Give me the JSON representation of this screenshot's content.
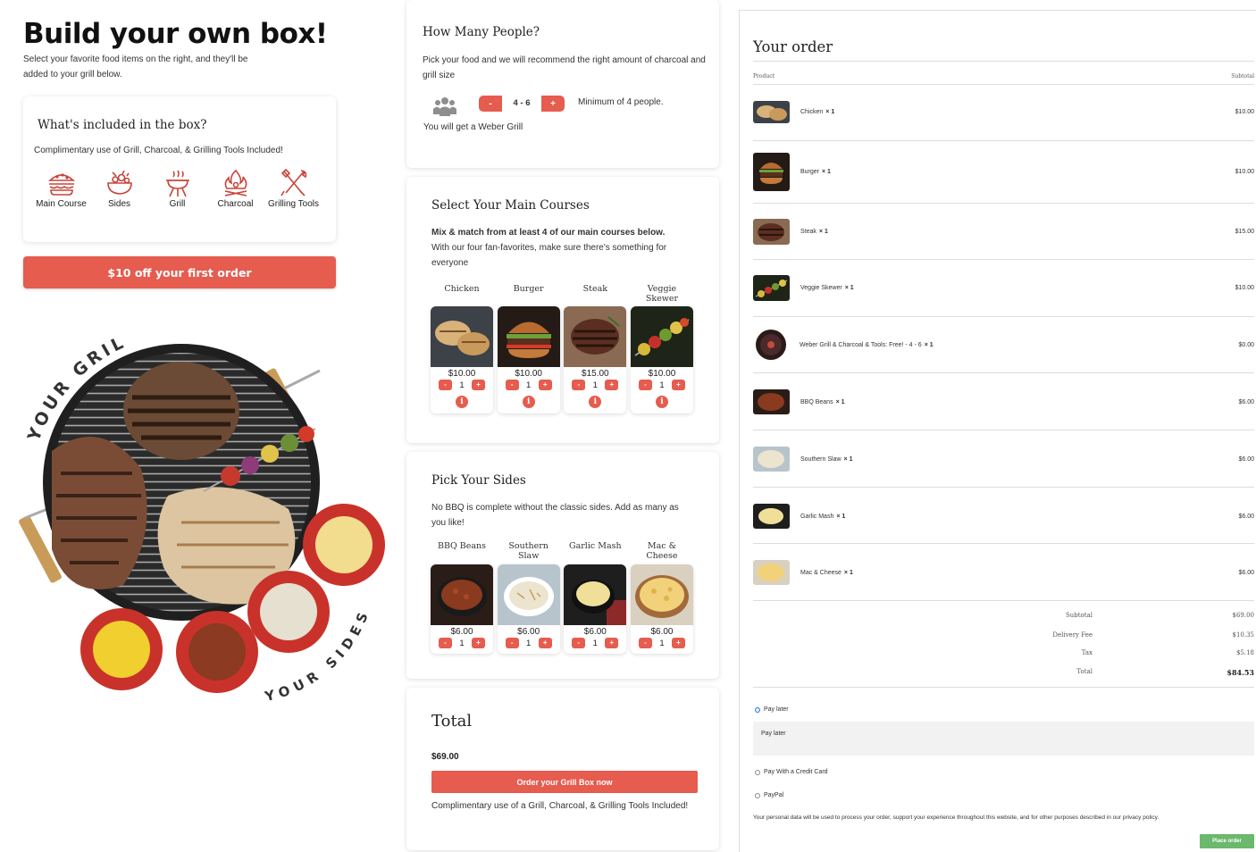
{
  "hero": {
    "title": "Build your own box!",
    "subtitle": "Select your favorite food items on the right, and they'll be added to your grill below."
  },
  "included": {
    "title": "What's included in the box?",
    "text": "Complimentary use of Grill, Charcoal, & Grilling Tools Included!",
    "items": [
      {
        "label": "Main Course",
        "icon": "burger-icon"
      },
      {
        "label": "Sides",
        "icon": "salad-bowl-icon"
      },
      {
        "label": "Grill",
        "icon": "grill-icon"
      },
      {
        "label": "Charcoal",
        "icon": "fire-icon"
      },
      {
        "label": "Grilling Tools",
        "icon": "tools-icon"
      }
    ]
  },
  "promo_button": "$10 off your first order",
  "grill_art": {
    "top_text": "YOUR GRILL",
    "bottom_text": "YOUR SIDES"
  },
  "people": {
    "title": "How Many People?",
    "text": "Pick your food and we will recommend the right amount of charcoal and grill size",
    "minus": "-",
    "value": "4 - 6",
    "plus": "+",
    "minimum_note": "Minimum of 4 people.",
    "grill_note": "You will get a Weber Grill"
  },
  "mains": {
    "title": "Select Your Main Courses",
    "text_bold": "Mix & match from at least 4 of our main courses below.",
    "text": "With our four fan-favorites, make sure there's something for everyone",
    "items": [
      {
        "name": "Chicken",
        "price": "$10.00",
        "qty": "1"
      },
      {
        "name": "Burger",
        "price": "$10.00",
        "qty": "1"
      },
      {
        "name": "Steak",
        "price": "$15.00",
        "qty": "1"
      },
      {
        "name": "Veggie Skewer",
        "price": "$10.00",
        "qty": "1"
      }
    ]
  },
  "sides": {
    "title": "Pick Your Sides",
    "text": "No BBQ is complete without the classic sides. Add as many as you like!",
    "items": [
      {
        "name": "BBQ Beans",
        "price": "$6.00",
        "qty": "1"
      },
      {
        "name": "Southern Slaw",
        "price": "$6.00",
        "qty": "1"
      },
      {
        "name": "Garlic Mash",
        "price": "$6.00",
        "qty": "1"
      },
      {
        "name": "Mac & Cheese",
        "price": "$6.00",
        "qty": "1"
      }
    ]
  },
  "total": {
    "title": "Total",
    "value": "$69.00",
    "button": "Order your Grill Box now",
    "note": "Complimentary use of a Grill, Charcoal, & Grilling Tools Included!"
  },
  "order": {
    "title": "Your order",
    "col_product": "Product",
    "col_subtotal": "Subtotal",
    "items": [
      {
        "name": "Chicken",
        "qty": "× 1",
        "price": "$10.00"
      },
      {
        "name": "Burger",
        "qty": "× 1",
        "price": "$10.00"
      },
      {
        "name": "Steak",
        "qty": "× 1",
        "price": "$15.00"
      },
      {
        "name": "Veggie Skewer",
        "qty": "× 1",
        "price": "$10.00"
      },
      {
        "name": "Weber Grill & Charcoal & Tools: Free! - 4 - 6",
        "qty": "× 1",
        "price": "$0.00"
      },
      {
        "name": "BBQ Beans",
        "qty": "× 1",
        "price": "$6.00"
      },
      {
        "name": "Southern Slaw",
        "qty": "× 1",
        "price": "$6.00"
      },
      {
        "name": "Garlic Mash",
        "qty": "× 1",
        "price": "$6.00"
      },
      {
        "name": "Mac & Cheese",
        "qty": "× 1",
        "price": "$6.00"
      }
    ],
    "totals": [
      {
        "label": "Subtotal",
        "value": "$69.00"
      },
      {
        "label": "Delivery Fee",
        "value": "$10.35"
      },
      {
        "label": "Tax",
        "value": "$5.18"
      },
      {
        "label": "Total",
        "value": "$84.53"
      }
    ],
    "payment": {
      "pay_later": "Pay later",
      "pay_later_desc": "Pay later",
      "credit_card": "Pay With a Credit Card",
      "paypal": "PayPal"
    },
    "privacy": "Your personal data will be used to process your order, support your experience throughout this website, and for other purposes described in our privacy policy.",
    "place_order": "Place order"
  },
  "colors": {
    "accent": "#e65c4f",
    "place_order": "#6cb86c",
    "radio_selected": "#2b72e6"
  }
}
